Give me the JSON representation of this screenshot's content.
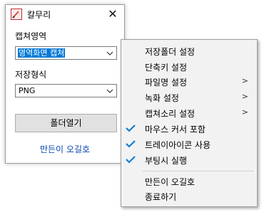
{
  "window": {
    "title": "칼무리",
    "close_glyph": "✕",
    "capture_area_label": "캡쳐영역",
    "capture_area_value": "영역화면 캡쳐",
    "save_format_label": "저장형식",
    "save_format_value": "PNG",
    "open_folder_button": "폴더열기",
    "about_link": "만든이 오길호"
  },
  "menu": {
    "items": [
      {
        "label": "저장폴더 설정",
        "submenu": false,
        "checked": false
      },
      {
        "label": "단축키 설정",
        "submenu": false,
        "checked": false
      },
      {
        "label": "파일명 설정",
        "submenu": true,
        "checked": false
      },
      {
        "label": "녹화 설정",
        "submenu": true,
        "checked": false
      },
      {
        "label": "캡쳐소리 설정",
        "submenu": true,
        "checked": false
      },
      {
        "label": "마우스 커서 포함",
        "submenu": false,
        "checked": true
      },
      {
        "label": "트레이아이콘 사용",
        "submenu": false,
        "checked": true
      },
      {
        "label": "부팅시 실행",
        "submenu": false,
        "checked": true
      },
      {
        "label": "만든이 오길호",
        "submenu": false,
        "checked": false
      },
      {
        "label": "종료하기",
        "submenu": false,
        "checked": false
      }
    ],
    "submenu_glyph": ">"
  },
  "colors": {
    "selection": "#0078d7",
    "check": "#0078d7",
    "link": "#0645ad"
  }
}
